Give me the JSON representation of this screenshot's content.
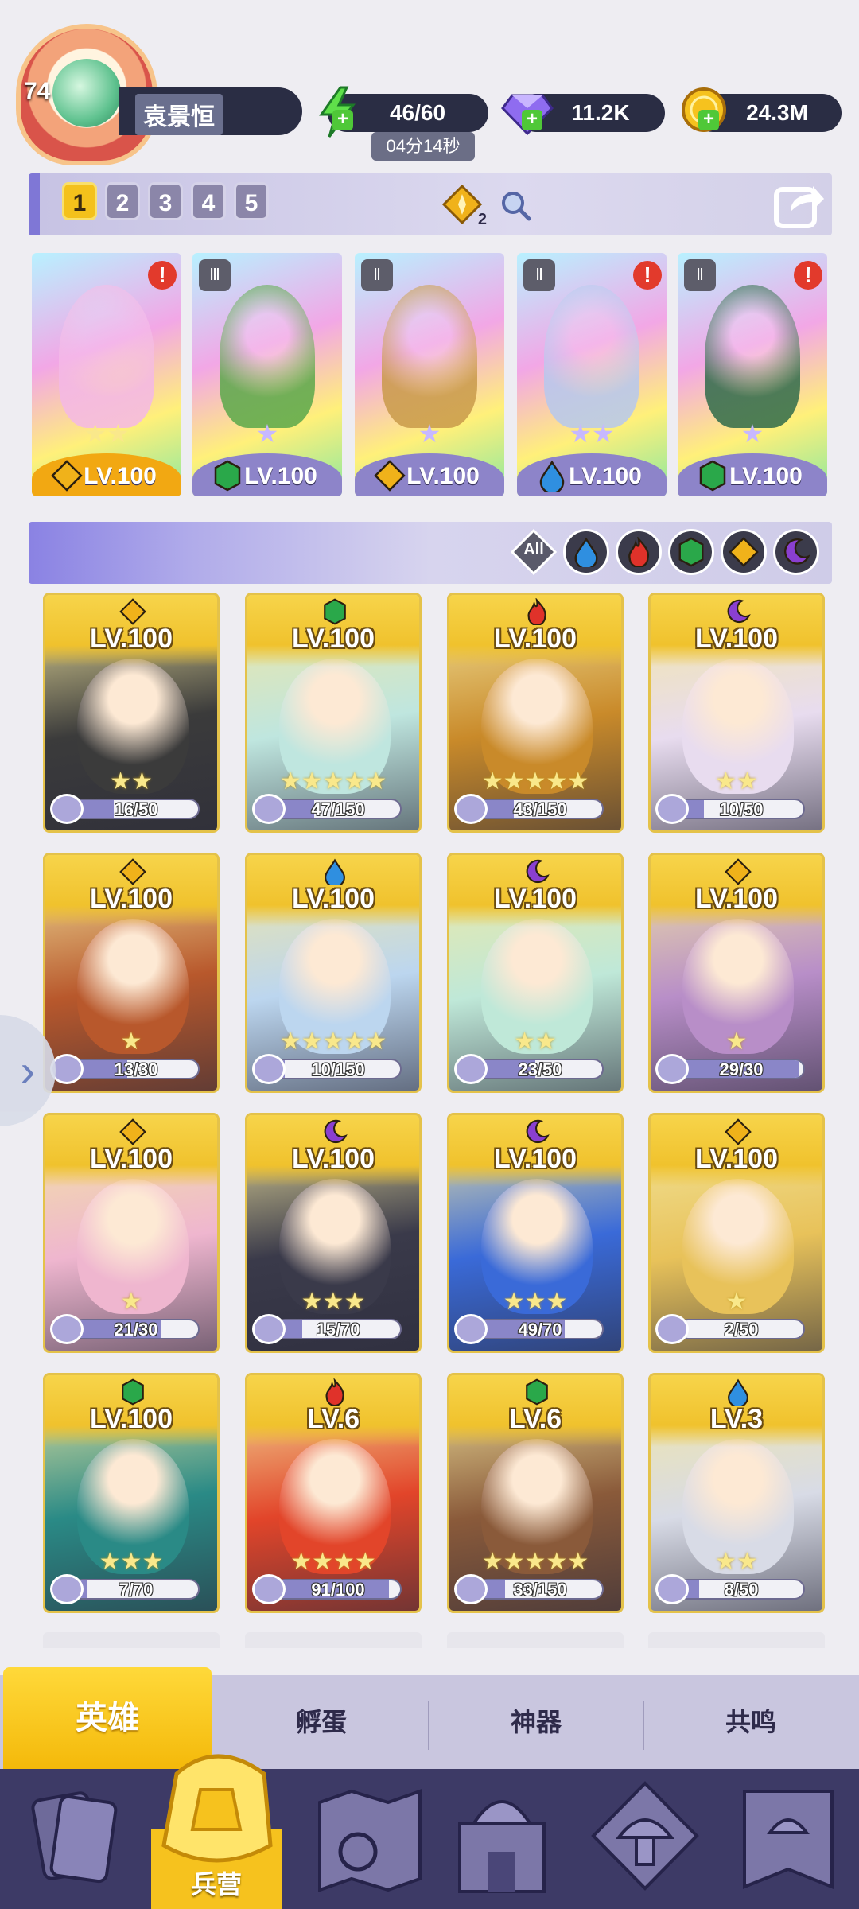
{
  "player": {
    "level": "74",
    "name": "袁景恒"
  },
  "resources": {
    "energy": "46/60",
    "energy_timer": "04分14秒",
    "gems": "11.2K",
    "gold": "24.3M"
  },
  "team_tabs": [
    "1",
    "2",
    "3",
    "4",
    "5"
  ],
  "team_cost": "2",
  "team_heroes": [
    {
      "level": "LV.100",
      "element": "light",
      "stars": "★★",
      "alert": "!",
      "rank": ""
    },
    {
      "level": "LV.100",
      "element": "nature",
      "stars": "★",
      "alert": "",
      "rank": "Ⅲ"
    },
    {
      "level": "LV.100",
      "element": "light",
      "stars": "★",
      "alert": "",
      "rank": "Ⅱ"
    },
    {
      "level": "LV.100",
      "element": "water",
      "stars": "★★",
      "alert": "!",
      "rank": "Ⅱ"
    },
    {
      "level": "LV.100",
      "element": "nature",
      "stars": "★",
      "alert": "!",
      "rank": "Ⅱ"
    }
  ],
  "filters": {
    "all_label": "All",
    "elements": [
      "water",
      "fire",
      "nature",
      "light",
      "dark"
    ]
  },
  "colors": {
    "water": "#2f8fe0",
    "fire": "#e0322a",
    "nature": "#2aa84a",
    "light": "#f0b21a",
    "dark": "#8a3fd0",
    "accent": "#f4c11b"
  },
  "heroes": [
    {
      "level": "LV.100",
      "element": "light",
      "stars": "★★",
      "shards": "16/50",
      "fill": 0.32,
      "tone": "#3b3b3b"
    },
    {
      "level": "LV.100",
      "element": "nature",
      "stars": "★★★★★",
      "shards": "47/150",
      "fill": 0.31,
      "tone": "#bfe6df"
    },
    {
      "level": "LV.100",
      "element": "fire",
      "stars": "★★★★★",
      "shards": "43/150",
      "fill": 0.29,
      "tone": "#c98a2a"
    },
    {
      "level": "LV.100",
      "element": "dark",
      "stars": "★★",
      "shards": "10/50",
      "fill": 0.2,
      "tone": "#e8dcef"
    },
    {
      "level": "LV.100",
      "element": "light",
      "stars": "★",
      "shards": "13/30",
      "fill": 0.43,
      "tone": "#b8582c"
    },
    {
      "level": "LV.100",
      "element": "water",
      "stars": "★★★★★",
      "shards": "10/150",
      "fill": 0.07,
      "tone": "#bcd6ef"
    },
    {
      "level": "LV.100",
      "element": "dark",
      "stars": "★★",
      "shards": "23/50",
      "fill": 0.46,
      "tone": "#bfe8d8"
    },
    {
      "level": "LV.100",
      "element": "light",
      "stars": "★",
      "shards": "29/30",
      "fill": 0.97,
      "tone": "#b88ec8"
    },
    {
      "level": "LV.100",
      "element": "light",
      "stars": "★",
      "shards": "21/30",
      "fill": 0.7,
      "tone": "#efb6cf"
    },
    {
      "level": "LV.100",
      "element": "dark",
      "stars": "★★★",
      "shards": "15/70",
      "fill": 0.21,
      "tone": "#3a3a4a"
    },
    {
      "level": "LV.100",
      "element": "dark",
      "stars": "★★★",
      "shards": "49/70",
      "fill": 0.7,
      "tone": "#3a6ad8"
    },
    {
      "level": "LV.100",
      "element": "light",
      "stars": "★",
      "shards": "2/50",
      "fill": 0.04,
      "tone": "#e8c25a"
    },
    {
      "level": "LV.100",
      "element": "nature",
      "stars": "★★★",
      "shards": "7/70",
      "fill": 0.1,
      "tone": "#2a8a86"
    },
    {
      "level": "LV.6",
      "element": "fire",
      "stars": "★★★★",
      "shards": "91/100",
      "fill": 0.91,
      "tone": "#e2452a"
    },
    {
      "level": "LV.6",
      "element": "nature",
      "stars": "★★★★★",
      "shards": "33/150",
      "fill": 0.22,
      "tone": "#8a5a3a"
    },
    {
      "level": "LV.3",
      "element": "water",
      "stars": "★★",
      "shards": "8/50",
      "fill": 0.16,
      "tone": "#d8dbe6"
    }
  ],
  "category_tabs": [
    {
      "label": "英雄",
      "active": true
    },
    {
      "label": "孵蛋",
      "active": false
    },
    {
      "label": "神器",
      "active": false
    },
    {
      "label": "共鸣",
      "active": false
    }
  ],
  "bottom_nav": [
    {
      "icon": "cards-icon",
      "label": ""
    },
    {
      "icon": "barracks-icon",
      "label": "兵营",
      "active": true
    },
    {
      "icon": "map-icon",
      "label": ""
    },
    {
      "icon": "castle-icon",
      "label": ""
    },
    {
      "icon": "mushroom-icon",
      "label": ""
    },
    {
      "icon": "guild-banner-icon",
      "label": ""
    }
  ]
}
